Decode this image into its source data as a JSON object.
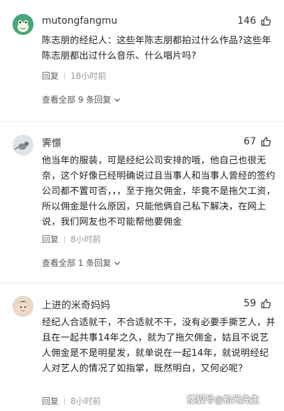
{
  "comments": [
    {
      "username": "mutongfangmu",
      "likes": "146",
      "text": "陈志朋的经纪人：这些年陈志朋都拍过什么作品?这些年陈志朋都出过什么音乐、什么唱片吗?",
      "reply_label": "回复",
      "time": "18小时前",
      "view_all": "查看全部 9 条回复"
    },
    {
      "username": "霁憬",
      "likes": "67",
      "text": "他当年的服装，可是经纪公司安排的哦，他自己也很无奈，这个好像已经明确说过且当事人和当事人曾经的签约公司都不置可否，，，至于拖欠佣金，毕竟不是拖欠工资，所以佣金是什么原因，只能他俩自己私下解决，在网上说，我们网友也不可能帮他要佣金",
      "reply_label": "回复",
      "time": "8小时前",
      "view_all": "查看全部 1 条回复"
    },
    {
      "username": "上进的米奇妈妈",
      "likes": "59",
      "text": "经纪人合适就干，不合适就不干，没有必要手撕艺人，并且在一起共事14年之久，就为了拖欠佣金，姑且不说艺人佣金是不是明星发，就单说在一起14年，就说明经纪人对艺人的情况了如指掌，既然明白，又何必呢？",
      "reply_label": "回复",
      "time": "8小时前"
    }
  ],
  "watermark": "搜狐号@拾光先生",
  "icons": {
    "like": "thumbs-up-icon",
    "expand": "chevron-down-icon"
  },
  "colors": {
    "avatar1": "#3fa77a",
    "text": "#222222",
    "meta": "#999999"
  }
}
